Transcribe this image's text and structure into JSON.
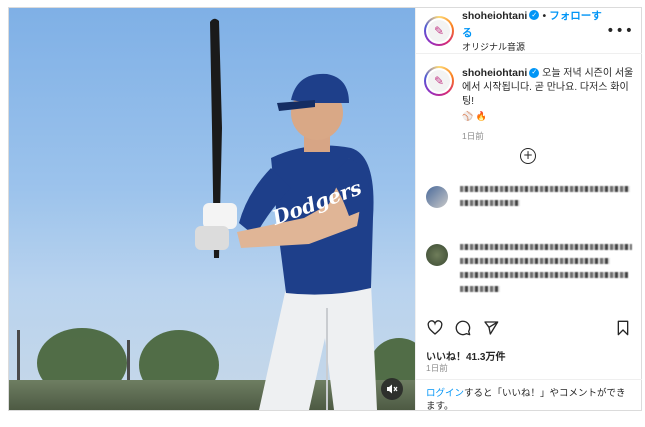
{
  "post": {
    "username": "shoheiohtani",
    "follow_label": "フォローする",
    "audio_label": "オリジナル音源",
    "caption_text": "오늘 저녁 시즌이 서울에서 시작됩니다. 곧 만나요. 다저스 화이팅!",
    "caption_emojis": "⚾ 🔥",
    "time_ago": "1日前",
    "likes_label": "いいね！41.3万件",
    "date": "1日前",
    "login_link": "ログイン",
    "login_text": "すると「いいね！」やコメントができます。"
  },
  "icons": {
    "more": "more-options-icon",
    "heart": "heart-icon",
    "comment": "comment-icon",
    "share": "share-icon",
    "bookmark": "bookmark-icon",
    "plus": "load-more-comments-icon",
    "mute": "muted-audio-icon",
    "verified": "verified-badge-icon"
  },
  "colors": {
    "accent": "#0095f6",
    "text": "#262626",
    "secondary": "#8e8e8e",
    "jersey": "#1e3f8a"
  }
}
